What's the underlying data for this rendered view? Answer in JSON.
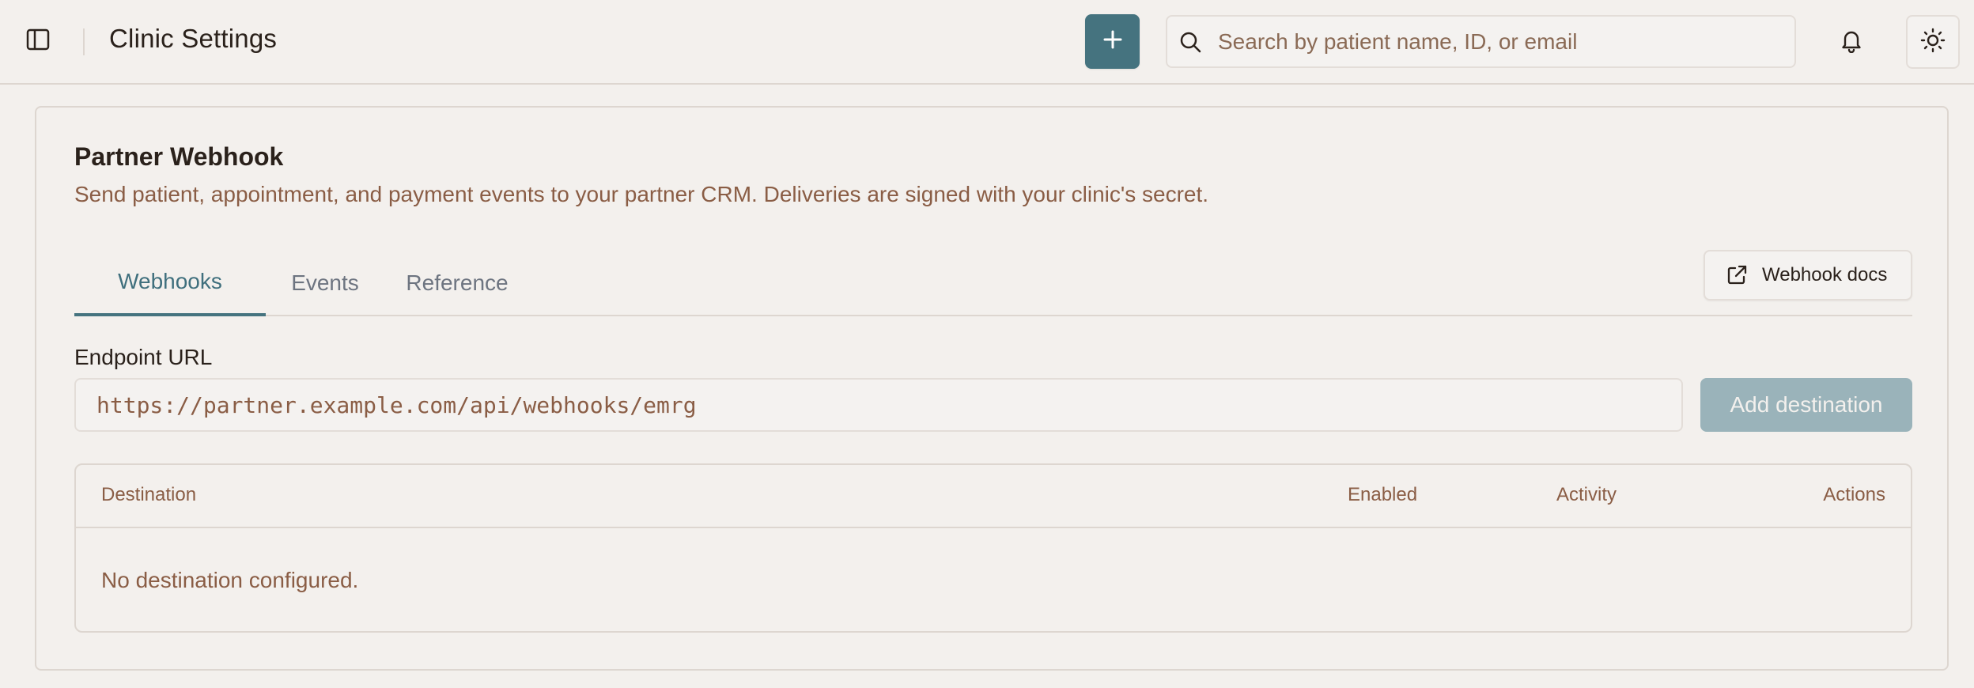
{
  "header": {
    "title": "Clinic Settings",
    "search_placeholder": "Search by patient name, ID, or email",
    "icons": {
      "sidebar_toggle": "sidebar-icon",
      "add": "plus-icon",
      "search": "search-icon",
      "notifications": "bell-icon",
      "theme": "sun-icon"
    }
  },
  "card": {
    "title": "Partner Webhook",
    "subtitle": "Send patient, appointment, and payment events to your partner CRM. Deliveries are signed with your clinic's secret.",
    "tabs": [
      {
        "label": "Webhooks",
        "active": true
      },
      {
        "label": "Events",
        "active": false
      },
      {
        "label": "Reference",
        "active": false
      }
    ],
    "docs_button": {
      "label": "Webhook docs",
      "icon": "external-link-icon"
    },
    "endpoint": {
      "label": "Endpoint URL",
      "placeholder": "https://partner.example.com/api/webhooks/emrg",
      "value": ""
    },
    "add_destination_label": "Add destination",
    "table": {
      "columns": [
        "Destination",
        "Enabled",
        "Activity",
        "Actions"
      ],
      "empty_message": "No destination configured."
    }
  },
  "colors": {
    "accent": "#45737f",
    "background": "#f3f0ed",
    "muted_text": "#8a5d45",
    "disabled_button": "#9ab3ba"
  }
}
